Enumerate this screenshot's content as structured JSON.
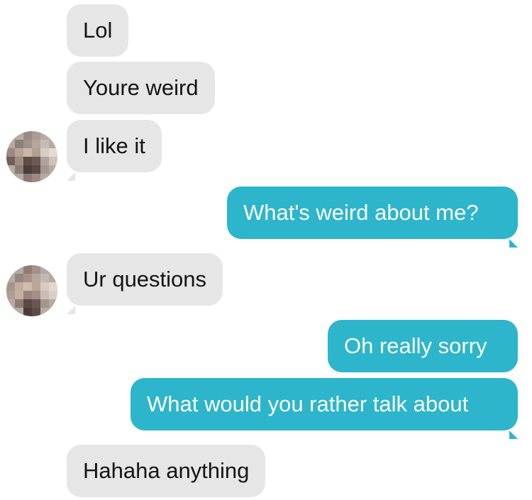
{
  "colors": {
    "incoming_bubble": "#e6e6e6",
    "outgoing_bubble": "#2db5cc",
    "incoming_text": "#141414",
    "outgoing_text": "#ffffff"
  },
  "messages": [
    {
      "direction": "incoming",
      "text": "Lol"
    },
    {
      "direction": "incoming",
      "text": "Youre weird"
    },
    {
      "direction": "incoming",
      "text": "I like it"
    },
    {
      "direction": "outgoing",
      "text": "What's weird about me?"
    },
    {
      "direction": "incoming",
      "text": "Ur questions"
    },
    {
      "direction": "outgoing",
      "text": "Oh really sorry"
    },
    {
      "direction": "outgoing",
      "text": "What would you rather talk about"
    },
    {
      "direction": "incoming",
      "text": "Hahaha anything"
    }
  ],
  "avatars": [
    {
      "icon": "pixelated-profile-photo-icon"
    },
    {
      "icon": "pixelated-profile-photo-icon"
    }
  ]
}
